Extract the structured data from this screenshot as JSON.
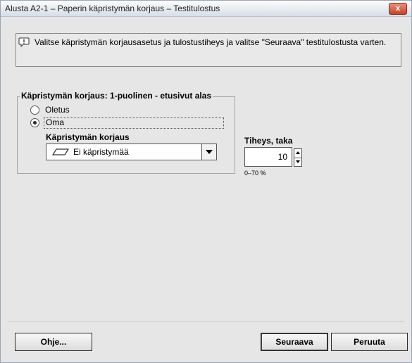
{
  "window": {
    "title": "Alusta A2-1 – Paperin käpristymän korjaus – Testitulostus",
    "close_label": "x"
  },
  "info": {
    "icon": "info-speech-bubble-icon",
    "text": "Valitse käpristymän korjausasetus ja tulostustiheys ja valitse \"Seuraava\" testitulostusta varten."
  },
  "group": {
    "legend": "Käpristymän korjaus: 1-puolinen - etusivut alas",
    "options": [
      {
        "label": "Oletus",
        "checked": false
      },
      {
        "label": "Oma",
        "checked": true
      }
    ]
  },
  "curl": {
    "label": "Käpristymän korjaus",
    "selected_icon": "flat-paper-icon",
    "selected": "Ei käpristymää"
  },
  "density": {
    "label": "Tiheys, taka",
    "value": "10",
    "range": "0–70 %"
  },
  "footer": {
    "help_label": "Ohje...",
    "next_label": "Seuraava",
    "cancel_label": "Peruuta"
  }
}
